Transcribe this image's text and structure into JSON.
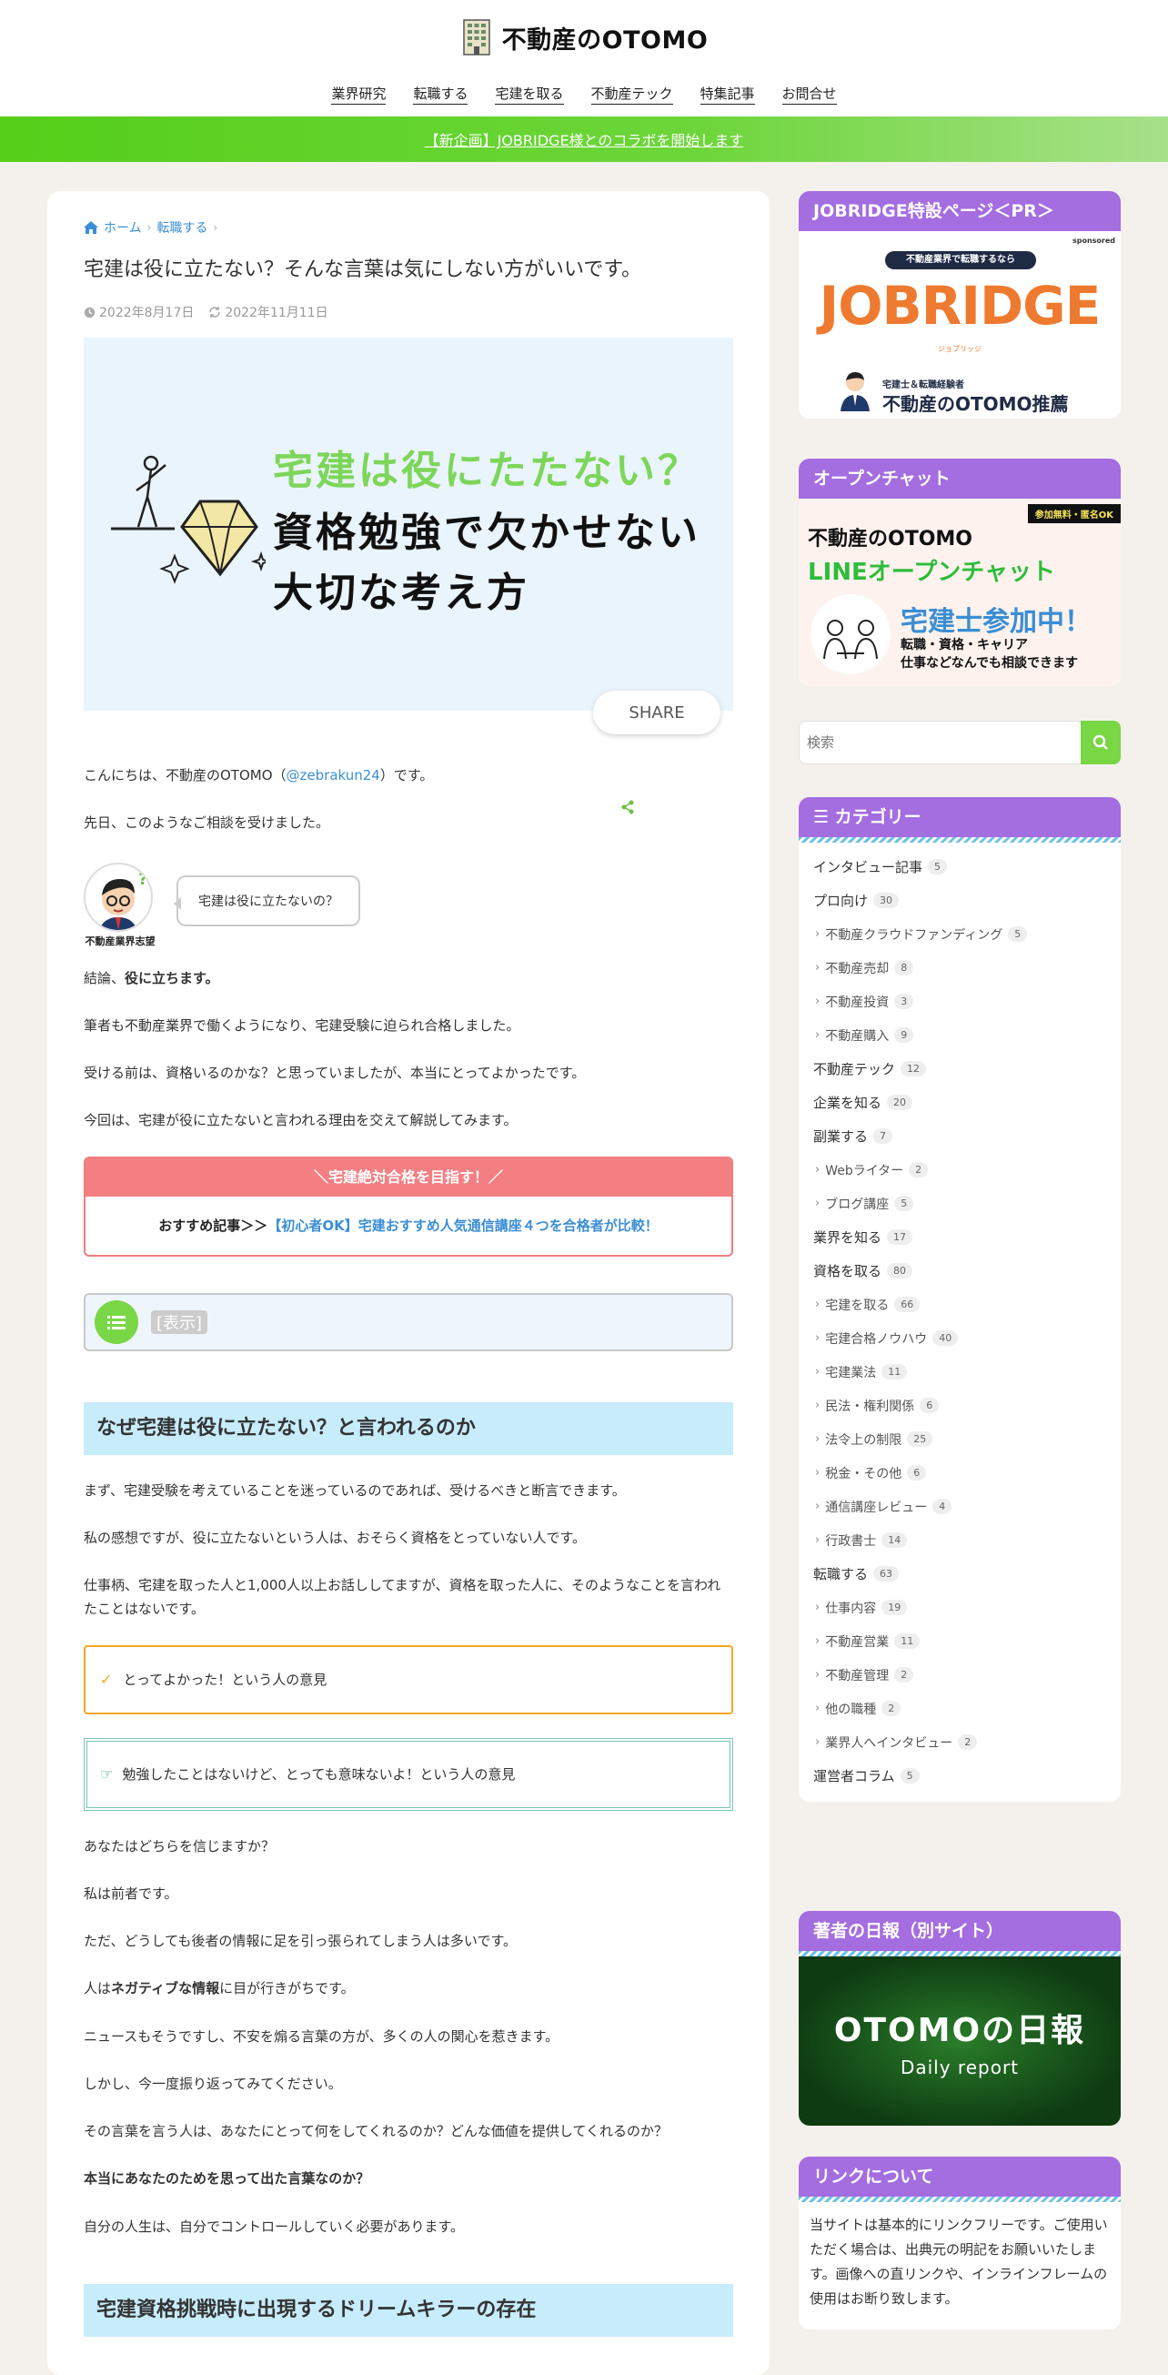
{
  "site": {
    "title": "不動産のOTOMO"
  },
  "nav": [
    "業界研究",
    "転職する",
    "宅建を取る",
    "不動産テック",
    "特集記事",
    "お問合せ"
  ],
  "banner": {
    "text": "【新企画】JOBRIDGE様とのコラボを開始します"
  },
  "breadcrumb": {
    "home": "ホーム",
    "category": "転職する"
  },
  "article": {
    "title": "宅建は役に立たない？そんな言葉は気にしない方がいいです。",
    "published": "2022年8月17日",
    "updated": "2022年11月11日",
    "eyecatch": {
      "line1": "宅建は役にたたない？",
      "line2": "資格勉強で欠かせない",
      "line3": "大切な考え方"
    },
    "share_label": "SHARE",
    "intro_pre": "こんにちは、不動産のOTOMO（",
    "intro_link": "@zebrakun24",
    "intro_post": "）です。",
    "p2": "先日、このようなご相談を受けました。",
    "speaker_name": "不動産業界志望",
    "speech": "宅建は役に立たないの？",
    "p3_pre": "結論、",
    "p3_bold": "役に立ちます。",
    "p4": "筆者も不動産業界で働くようになり、宅建受験に迫られ合格しました。",
    "p5": "受ける前は、資格いるのかな？と思っていましたが、本当にとってよかったです。",
    "p6": "今回は、宅建が役に立たないと言われる理由を交えて解説してみます。",
    "rec_head": "＼宅建絶対合格を目指す！／",
    "rec_pre": "おすすめ記事＞＞",
    "rec_link": "【初心者OK】宅建おすすめ人気通信講座４つを合格者が比較！",
    "toc_label": "[表示]",
    "h2_1": "なぜ宅建は役に立たない？と言われるのか",
    "p7": "まず、宅建受験を考えていることを迷っているのであれば、受けるべきと断言できます。",
    "p8": "私の感想ですが、役に立たないという人は、おそらく資格をとっていない人です。",
    "p9": "仕事柄、宅建を取った人と1,000人以上お話ししてますが、資格を取った人に、そのようなことを言われたことはないです。",
    "box1": "とってよかった！という人の意見",
    "box2": "勉強したことはないけど、とっても意味ないよ！という人の意見",
    "p10": "あなたはどちらを信じますか？",
    "p11": "私は前者です。",
    "p12": "ただ、どうしても後者の情報に足を引っ張られてしまう人は多いです。",
    "p13_pre": "人は",
    "p13_bold": "ネガティブな情報",
    "p13_post": "に目が行きがちです。",
    "p14": "ニュースもそうですし、不安を煽る言葉の方が、多くの人の関心を惹きます。",
    "p15": "しかし、今一度振り返ってみてください。",
    "p16": "その言葉を言う人は、あなたにとって何をしてくれるのか？どんな価値を提供してくれるのか？",
    "p17_bold": "本当にあなたのためを思って出た言葉なのか？",
    "p18": "自分の人生は、自分でコントロールしていく必要があります。",
    "h2_2": "宅建資格挑戦時に出現するドリームキラーの存在"
  },
  "sidebar": {
    "jobridge": {
      "head": "JOBRIDGE特設ページ＜PR＞",
      "sponsored": "sponsored",
      "pill": "不動産業界で転職するなら",
      "brand": "JOBRIDGE",
      "kana": "ジョブリッジ",
      "caption_small": "宅建士＆転職経験者",
      "caption_big": "不動産のOTOMO推薦"
    },
    "openchat": {
      "head": "オープンチャット",
      "tag": "参加無料・匿名OK",
      "l1": "不動産のOTOMO",
      "l2": "LINEオープンチャット",
      "l3": "宅建士参加中！",
      "l4": "転職・資格・キャリア",
      "l5": "仕事などなんでも相談できます"
    },
    "search": {
      "placeholder": "検索"
    },
    "categories": {
      "head": "カテゴリー",
      "items": [
        {
          "label": "インタビュー記事",
          "count": "5",
          "sub": false
        },
        {
          "label": "プロ向け",
          "count": "30",
          "sub": false
        },
        {
          "label": "不動産クラウドファンディング",
          "count": "5",
          "sub": true
        },
        {
          "label": "不動産売却",
          "count": "8",
          "sub": true
        },
        {
          "label": "不動産投資",
          "count": "3",
          "sub": true
        },
        {
          "label": "不動産購入",
          "count": "9",
          "sub": true
        },
        {
          "label": "不動産テック",
          "count": "12",
          "sub": false
        },
        {
          "label": "企業を知る",
          "count": "20",
          "sub": false
        },
        {
          "label": "副業する",
          "count": "7",
          "sub": false
        },
        {
          "label": "Webライター",
          "count": "2",
          "sub": true
        },
        {
          "label": "ブログ講座",
          "count": "5",
          "sub": true
        },
        {
          "label": "業界を知る",
          "count": "17",
          "sub": false
        },
        {
          "label": "資格を取る",
          "count": "80",
          "sub": false
        },
        {
          "label": "宅建を取る",
          "count": "66",
          "sub": true
        },
        {
          "label": "宅建合格ノウハウ",
          "count": "40",
          "sub": true
        },
        {
          "label": "宅建業法",
          "count": "11",
          "sub": true
        },
        {
          "label": "民法・権利関係",
          "count": "6",
          "sub": true
        },
        {
          "label": "法令上の制限",
          "count": "25",
          "sub": true
        },
        {
          "label": "税金・その他",
          "count": "6",
          "sub": true
        },
        {
          "label": "通信講座レビュー",
          "count": "4",
          "sub": true
        },
        {
          "label": "行政書士",
          "count": "14",
          "sub": true
        },
        {
          "label": "転職する",
          "count": "63",
          "sub": false
        },
        {
          "label": "仕事内容",
          "count": "19",
          "sub": true
        },
        {
          "label": "不動産営業",
          "count": "11",
          "sub": true
        },
        {
          "label": "不動産管理",
          "count": "2",
          "sub": true
        },
        {
          "label": "他の職種",
          "count": "2",
          "sub": true
        },
        {
          "label": "業界人へインタビュー",
          "count": "2",
          "sub": true
        },
        {
          "label": "運営者コラム",
          "count": "5",
          "sub": false
        }
      ]
    },
    "diary": {
      "head": "著者の日報（別サイト）",
      "t1": "OTOMOの日報",
      "t2": "Daily report"
    },
    "links": {
      "head": "リンクについて",
      "text": "当サイトは基本的にリンクフリーです。ご使用いただく場合は、出典元の明記をお願いいたします。画像への直リンクや、インラインフレームの使用はお断り致します。"
    }
  }
}
